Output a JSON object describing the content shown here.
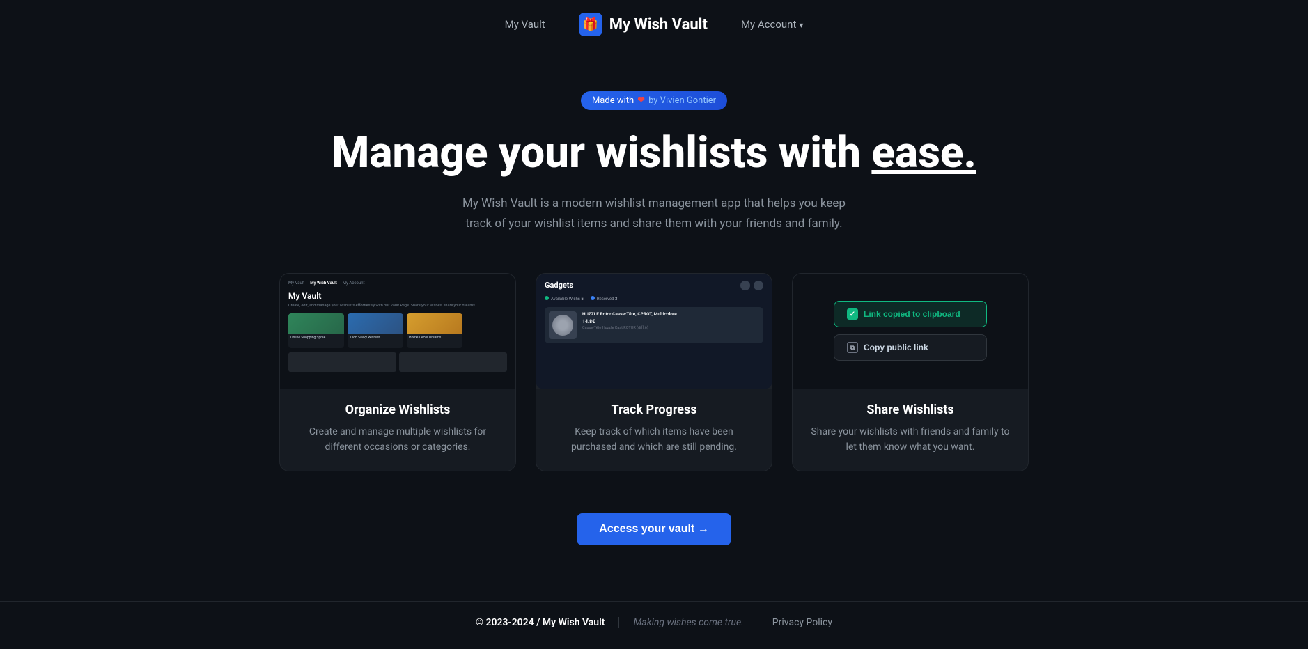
{
  "nav": {
    "vault_link": "My Vault",
    "brand_label": "My Wish Vault",
    "brand_icon": "🎁",
    "account_label": "My Account"
  },
  "hero": {
    "badge_text": "Made with",
    "badge_heart": "❤",
    "badge_by": "by Vivien Gontier",
    "title_start": "Manage your wishlists with ",
    "title_highlight": "ease.",
    "subtitle": "My Wish Vault is a modern wishlist management app that helps you keep track of your wishlist items and share them with your friends and family."
  },
  "features": [
    {
      "title": "Organize Wishlists",
      "description": "Create and manage multiple wishlists for different occasions or categories.",
      "mockup_type": "organize"
    },
    {
      "title": "Track Progress",
      "description": "Keep track of which items have been purchased and which are still pending.",
      "mockup_type": "track"
    },
    {
      "title": "Share Wishlists",
      "description": "Share your wishlists with friends and family to let them know what you want.",
      "mockup_type": "share"
    }
  ],
  "track_mockup": {
    "list_title": "Gadgets",
    "stat_available_label": "Available Wishs",
    "stat_available_count": "5",
    "stat_reserved_label": "Reserved",
    "stat_reserved_count": "3",
    "item_name": "HUZZLE Rotor Casse-Tête, CPROT, Multicolore",
    "item_price": "14.8€",
    "item_subtitle": "Casse-Tête Huzzle Cast ROTOR (diff.6)"
  },
  "share_mockup": {
    "btn_copied": "Link copied to clipboard",
    "btn_copy_public": "Copy public link"
  },
  "cta": {
    "label": "Access your vault →"
  },
  "footer": {
    "copyright": "© 2023-2024 / My Wish Vault",
    "tagline": "Making wishes come true.",
    "policy": "Privacy Policy"
  }
}
